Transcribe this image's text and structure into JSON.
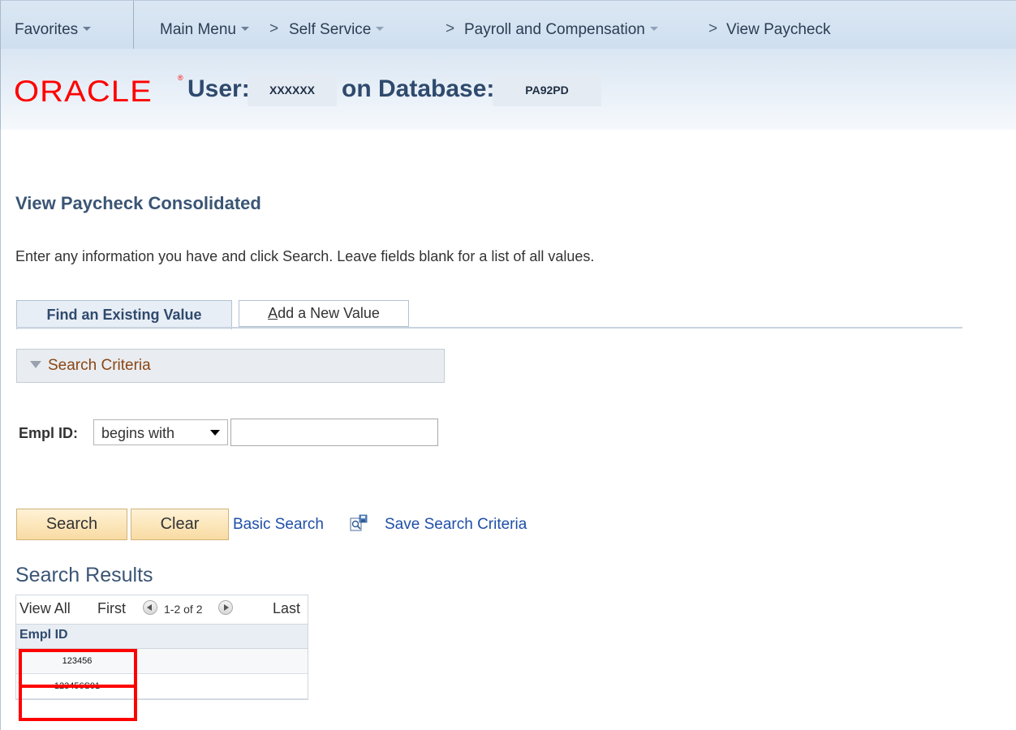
{
  "nav": {
    "favorites": "Favorites",
    "main_menu": "Main Menu",
    "self_service": "Self Service",
    "payroll": "Payroll and Compensation",
    "view_paycheck": "View Paycheck",
    "separator": ">"
  },
  "header": {
    "logo": "ORACLE",
    "logo_mark": "®",
    "user_label": "User:",
    "user_value": "XXXXXX",
    "database_label": "on Database:",
    "database_value": "PA92PD"
  },
  "page": {
    "title": "View Paycheck Consolidated",
    "instructions": "Enter any information you have and click Search. Leave fields blank for a list of all values."
  },
  "tabs": {
    "find_existing": "Find an Existing Value",
    "add_new_first": "A",
    "add_new_rest": "dd a New Value"
  },
  "criteria": {
    "label": "Search Criteria",
    "field_label": "Empl ID:",
    "operator": "begins with",
    "value": ""
  },
  "actions": {
    "search": "Search",
    "clear": "Clear",
    "basic_search": "Basic Search",
    "save_search": "Save Search Criteria"
  },
  "results": {
    "title": "Search Results",
    "view_all": "View All",
    "first": "First",
    "count": "1-2 of 2",
    "last": "Last",
    "column": "Empl ID",
    "rows": [
      "123456",
      "123456S01"
    ]
  },
  "colors": {
    "highlight": "#ff0000",
    "link": "#1f4fa8",
    "title": "#3a5574"
  }
}
